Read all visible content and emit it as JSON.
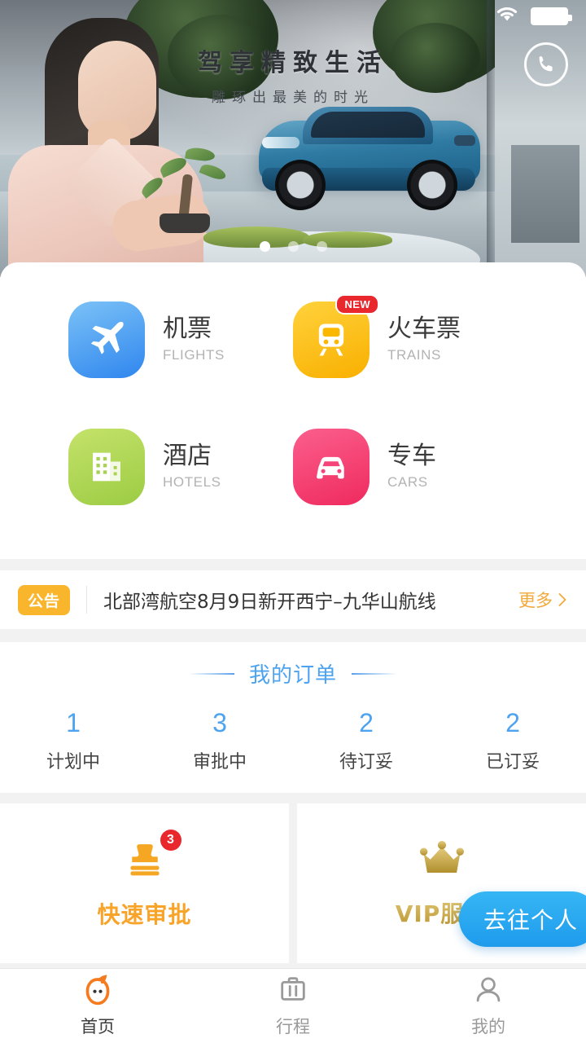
{
  "status_bar": {
    "wifi_icon": "wifi-icon",
    "battery_icon": "battery-full-icon"
  },
  "banner": {
    "title": "驾享精致生活",
    "subtitle": "雕琢出最美的时光",
    "call_icon": "phone-call-icon",
    "dots": [
      "active",
      "inactive",
      "inactive"
    ]
  },
  "services": [
    {
      "cn": "机票",
      "en": "FLIGHTS",
      "icon": "airplane-icon",
      "color": "#2f86ee",
      "badge": ""
    },
    {
      "cn": "火车票",
      "en": "TRAINS",
      "icon": "train-icon",
      "color": "#f9b000",
      "badge": "NEW"
    },
    {
      "cn": "酒店",
      "en": "HOTELS",
      "icon": "building-icon",
      "color": "#9ccc44",
      "badge": ""
    },
    {
      "cn": "专车",
      "en": "CARS",
      "icon": "car-icon",
      "color": "#ef2a5e",
      "badge": ""
    }
  ],
  "notice": {
    "badge": "公告",
    "text": "北部湾航空8月9日新开西宁–九华山航线",
    "more": "更多",
    "more_icon": "chevron-right-icon",
    "badge_color": "#f9b52c"
  },
  "orders": {
    "title": "我的订单",
    "accent_color": "#4da3f0",
    "items": [
      {
        "count": "1",
        "label": "计划中"
      },
      {
        "count": "3",
        "label": "审批中"
      },
      {
        "count": "2",
        "label": "待订妥"
      },
      {
        "count": "2",
        "label": "已订妥"
      }
    ]
  },
  "features": [
    {
      "title": "快速审批",
      "icon": "stamp-icon",
      "badge": "3",
      "color": "#f7a429"
    },
    {
      "title": "VIP服务",
      "icon": "crown-icon",
      "badge": "",
      "color": "#b9952f"
    }
  ],
  "floating": {
    "label": "去往个人",
    "color": "#1e9bec"
  },
  "tabbar": [
    {
      "label": "首页",
      "icon": "home-mascot-icon",
      "active": true
    },
    {
      "label": "行程",
      "icon": "suitcase-icon",
      "active": false
    },
    {
      "label": "我的",
      "icon": "person-icon",
      "active": false
    }
  ]
}
